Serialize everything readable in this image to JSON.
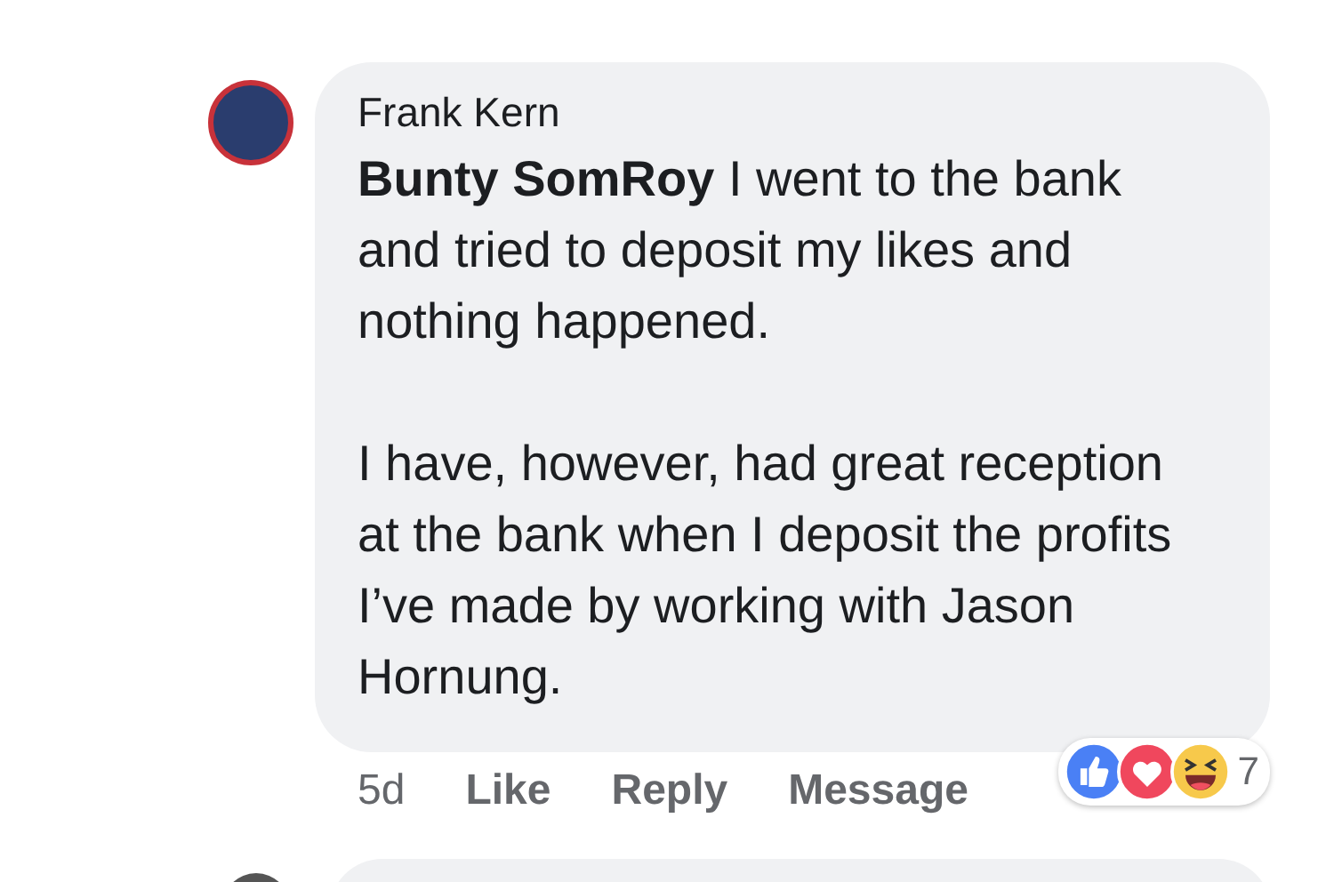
{
  "comment": {
    "author": "Frank Kern",
    "paragraphs": [
      "**Bunty SomRoy** I went to the bank and tried to deposit my likes and nothing happened.",
      "I have, however, had great reception at the bank when I deposit the profits I’ve made by working with Jason Hornung."
    ],
    "time": "5d",
    "actions": [
      "Like",
      "Reply",
      "Message"
    ],
    "reactions": {
      "icons": [
        {
          "kind": "like"
        },
        {
          "kind": "love"
        },
        {
          "kind": "haha"
        }
      ],
      "count": "7"
    }
  }
}
